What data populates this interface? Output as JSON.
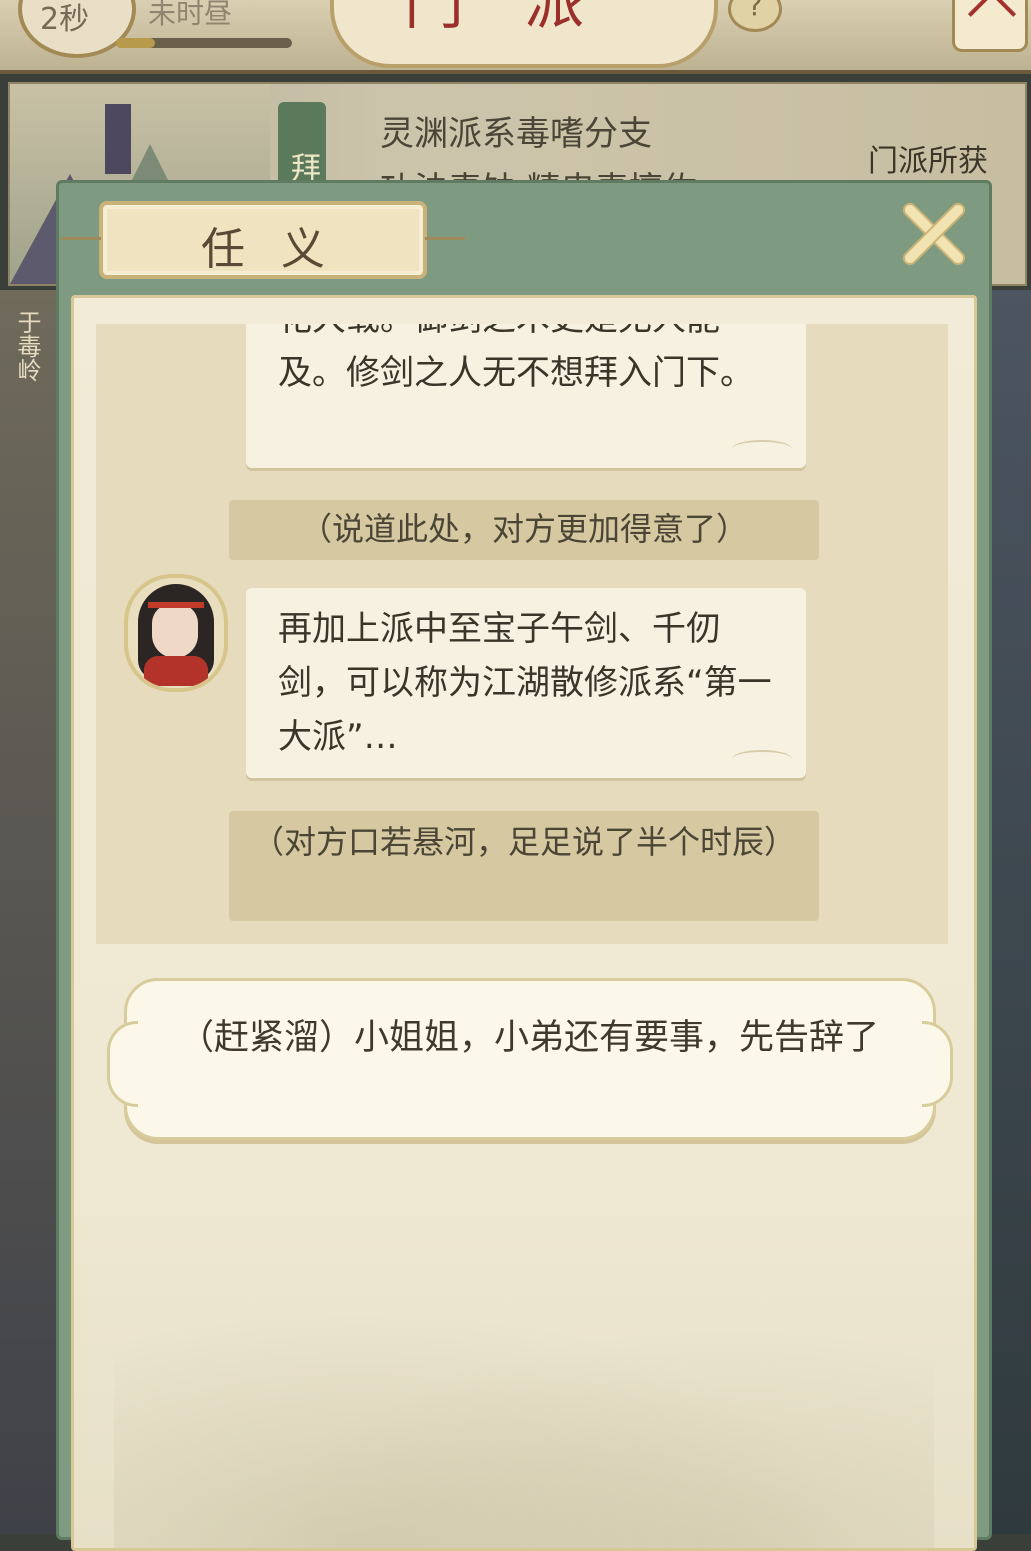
{
  "top_bar": {
    "level_text": "2秒",
    "time_text": "未时昼",
    "title": "门派",
    "help_icon": "?",
    "progress": 0.22
  },
  "sect_info": {
    "tag": "拜月",
    "desc_line1": "灵渊派系毒嗜分支",
    "desc_line2": "功法毒蚀 精忠毒擅佐",
    "gain_label": "门派所获"
  },
  "left_side_label": "于毒岭",
  "dialog": {
    "title": "任义",
    "close_icon": "close-icon",
    "messages": [
      {
        "type": "speech",
        "text": "花大载。御剑之术更是无人能及。修剑之人无不想拜入门下。"
      },
      {
        "type": "narration",
        "text": "（说道此处，对方更加得意了）"
      },
      {
        "type": "speech",
        "text": "再加上派中至宝子午剑、千仞剑，可以称为江湖散修派系“第一大派”…"
      },
      {
        "type": "narration",
        "text": "（对方口若悬河，足足说了半个时辰）"
      }
    ],
    "choice": "（赶紧溜）小姐姐，小弟还有要事，先告辞了"
  },
  "colors": {
    "frame_green": "#7e9a80",
    "paper": "#f1ebd7",
    "narration_bg": "#d6c9a2",
    "title_red": "#9b2f2a"
  }
}
